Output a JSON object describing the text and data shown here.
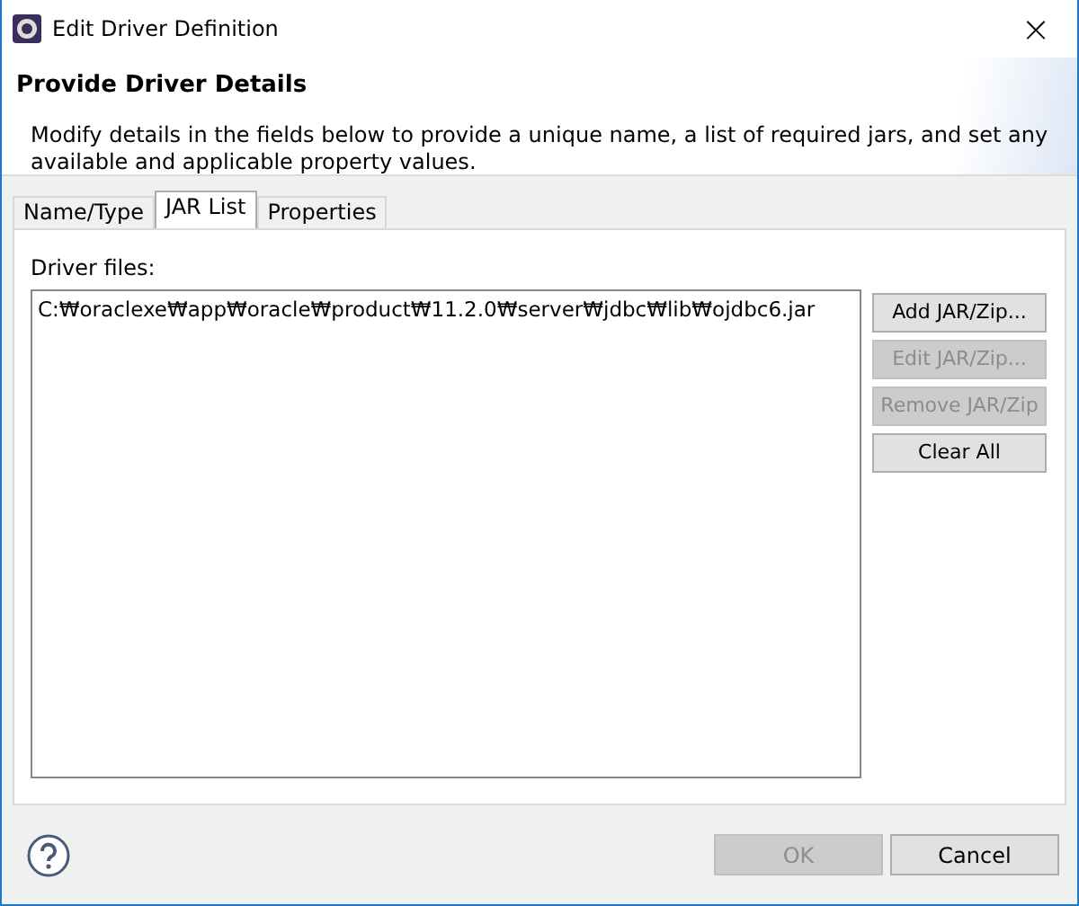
{
  "window": {
    "title": "Edit Driver Definition",
    "close": "×"
  },
  "header": {
    "title": "Provide Driver Details",
    "description": "Modify details in the fields below to provide a unique name, a list of required jars, and set any available and applicable property values."
  },
  "tabs": [
    {
      "label": "Name/Type",
      "selected": false
    },
    {
      "label": "JAR List",
      "selected": true
    },
    {
      "label": "Properties",
      "selected": false
    }
  ],
  "driver_files": {
    "label": "Driver files:",
    "items": [
      {
        "path": "C:₩oraclexe₩app₩oracle₩product₩11.2.0₩server₩jdbc₩lib₩ojdbc6.jar",
        "selected": false
      }
    ]
  },
  "side_buttons": [
    {
      "label": "Add JAR/Zip...",
      "disabled": false
    },
    {
      "label": "Edit JAR/Zip...",
      "disabled": true
    },
    {
      "label": "Remove JAR/Zip",
      "disabled": true
    },
    {
      "label": "Clear All",
      "disabled": false
    }
  ],
  "footer_buttons": [
    {
      "label": "OK",
      "disabled": true
    },
    {
      "label": "Cancel",
      "disabled": false
    }
  ]
}
